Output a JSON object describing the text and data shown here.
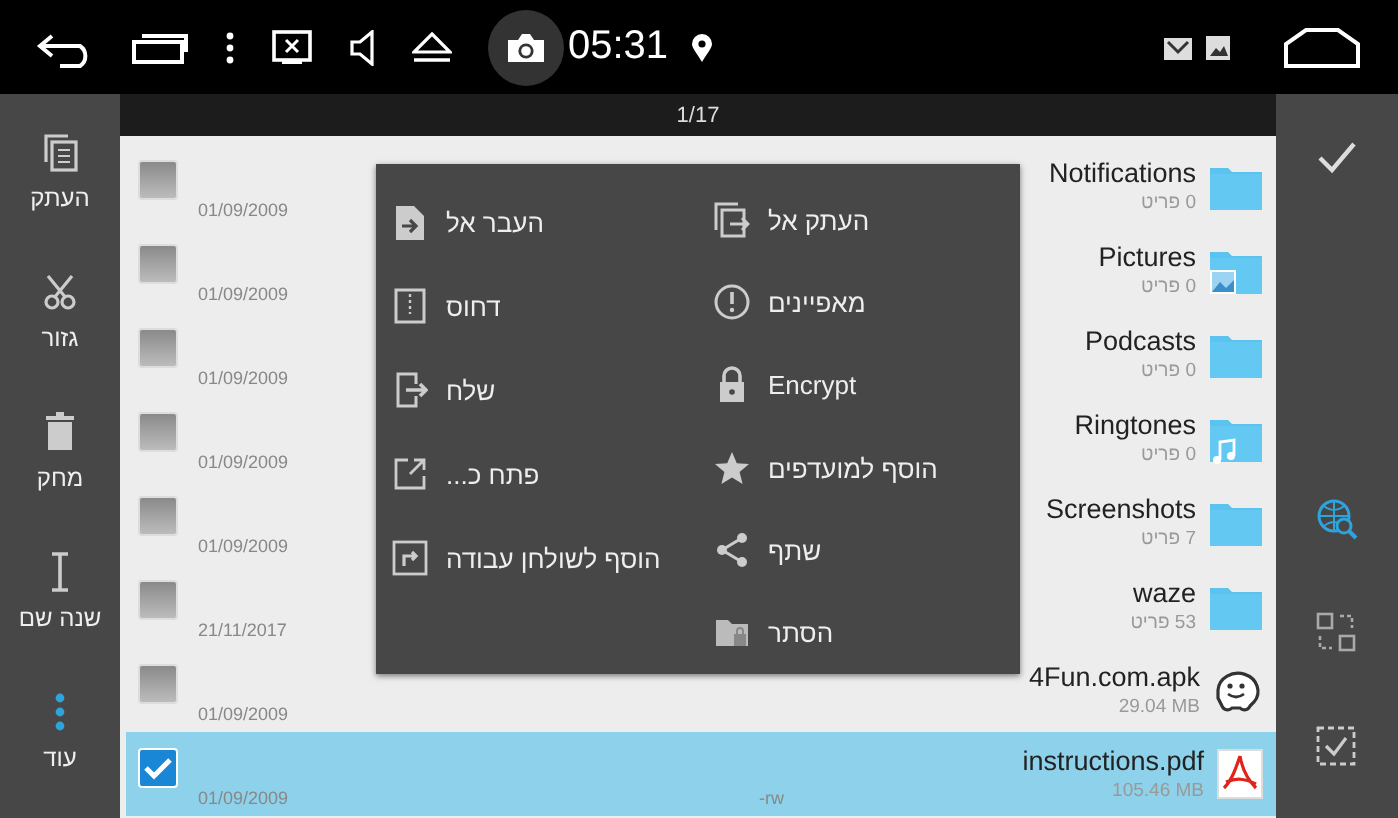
{
  "status_bar": {
    "time": "05:31"
  },
  "counter": "1/17",
  "left_toolbar": [
    {
      "label": "העתק",
      "kind": "copy"
    },
    {
      "label": "גזור",
      "kind": "cut"
    },
    {
      "label": "מחק",
      "kind": "delete"
    },
    {
      "label": "שנה שם",
      "kind": "rename"
    },
    {
      "label": "עוד",
      "kind": "more"
    }
  ],
  "right_toolbar": [
    {
      "kind": "confirm"
    },
    {
      "kind": "web-search"
    },
    {
      "kind": "select-range"
    },
    {
      "kind": "select-all"
    }
  ],
  "files": [
    {
      "name": "Notifications",
      "detail": "0 פריט",
      "date": "01/09/2009",
      "checked": false,
      "kind": "folder"
    },
    {
      "name": "Pictures",
      "detail": "0 פריט",
      "date": "01/09/2009",
      "checked": false,
      "kind": "folder-pictures"
    },
    {
      "name": "Podcasts",
      "detail": "0 פריט",
      "date": "01/09/2009",
      "checked": false,
      "kind": "folder"
    },
    {
      "name": "Ringtones",
      "detail": "0 פריט",
      "date": "01/09/2009",
      "checked": false,
      "kind": "folder-music"
    },
    {
      "name": "Screenshots",
      "detail": "7 פריט",
      "date": "01/09/2009",
      "checked": false,
      "kind": "folder"
    },
    {
      "name": "waze",
      "detail": "53 פריט",
      "date": "21/11/2017",
      "checked": false,
      "kind": "folder"
    },
    {
      "name": "4Fun.com.apk",
      "detail": "29.04 MB",
      "date": "01/09/2009",
      "checked": false,
      "kind": "apk"
    },
    {
      "name": "instructions.pdf",
      "detail": "105.46 MB",
      "date": "01/09/2009",
      "permissions": "-rw",
      "checked": true,
      "kind": "pdf"
    }
  ],
  "context_menu": {
    "columns": [
      [
        {
          "label": "העתק אל",
          "kind": "copy-to"
        },
        {
          "label": "מאפיינים",
          "kind": "properties"
        },
        {
          "label": "Encrypt",
          "kind": "encrypt"
        },
        {
          "label": "הוסף למועדפים",
          "kind": "favorite"
        },
        {
          "label": "שתף",
          "kind": "share"
        },
        {
          "label": "הסתר",
          "kind": "hide"
        }
      ],
      [
        {
          "label": "העבר אל",
          "kind": "move-to"
        },
        {
          "label": "דחוס",
          "kind": "compress"
        },
        {
          "label": "שלח",
          "kind": "send"
        },
        {
          "label": "פתח כ...",
          "kind": "open-as"
        },
        {
          "label": "הוסף לשולחן עבודה",
          "kind": "desktop"
        }
      ]
    ]
  }
}
